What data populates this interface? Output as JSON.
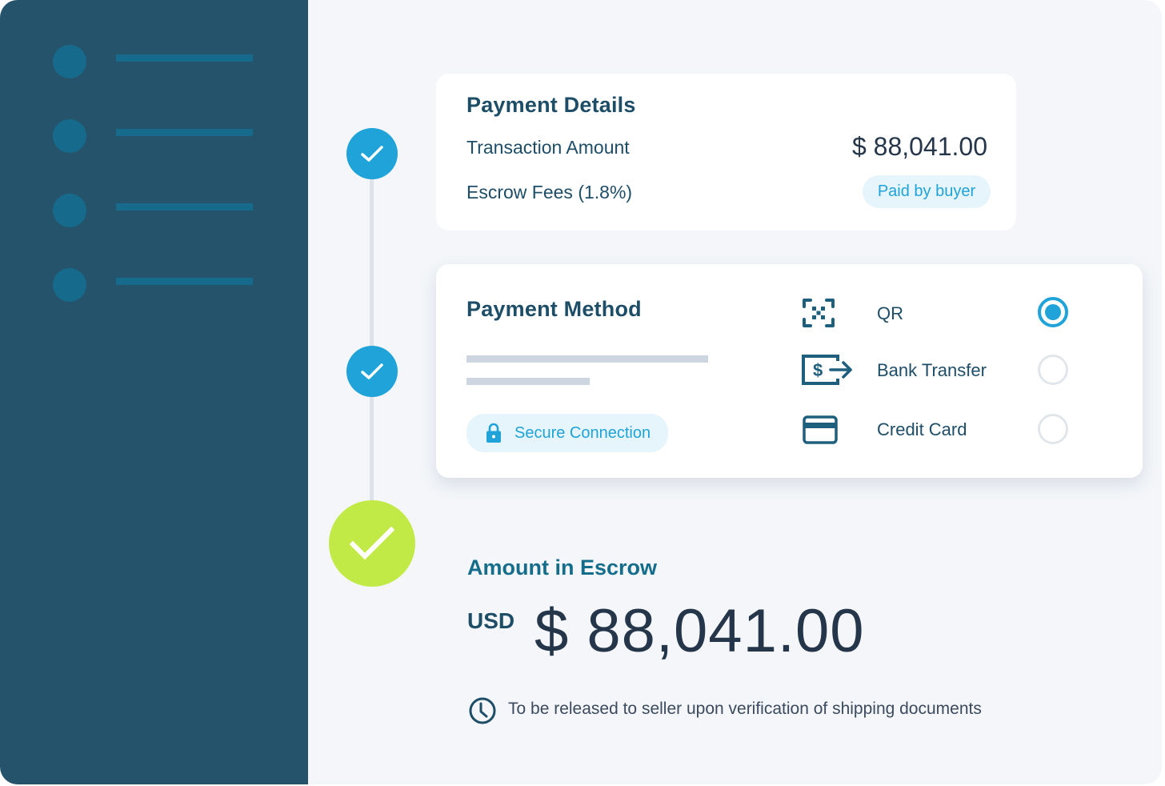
{
  "sidebar": {
    "items": [
      {
        "icon": "placeholder-dot"
      },
      {
        "icon": "placeholder-dot"
      },
      {
        "icon": "placeholder-dot"
      },
      {
        "icon": "placeholder-dot"
      }
    ]
  },
  "timeline": {
    "steps": [
      {
        "status": "complete",
        "icon": "check-icon"
      },
      {
        "status": "complete",
        "icon": "check-icon"
      },
      {
        "status": "complete",
        "icon": "check-icon"
      }
    ]
  },
  "payment_details": {
    "title": "Payment Details",
    "transaction_label": "Transaction Amount",
    "transaction_value": "$ 88,041.00",
    "fees_label": "Escrow Fees (1.8%)",
    "fees_badge": "Paid by buyer"
  },
  "payment_method": {
    "title": "Payment Method",
    "secure_badge": "Secure Connection",
    "options": [
      {
        "label": "QR",
        "icon": "qr-scan-icon",
        "selected": true
      },
      {
        "label": "Bank Transfer",
        "icon": "bank-transfer-icon",
        "selected": false
      },
      {
        "label": "Credit Card",
        "icon": "credit-card-icon",
        "selected": false
      }
    ]
  },
  "escrow": {
    "title": "Amount in Escrow",
    "currency": "USD",
    "amount": "$ 88,041.00",
    "note": "To be released to seller upon verification of shipping documents"
  },
  "colors": {
    "sidebar": "#26536c",
    "accent_blue": "#1fa3d8",
    "accent_green": "#c2ea46",
    "text_dark": "#1d4d67",
    "background": "#f4f6f9"
  }
}
